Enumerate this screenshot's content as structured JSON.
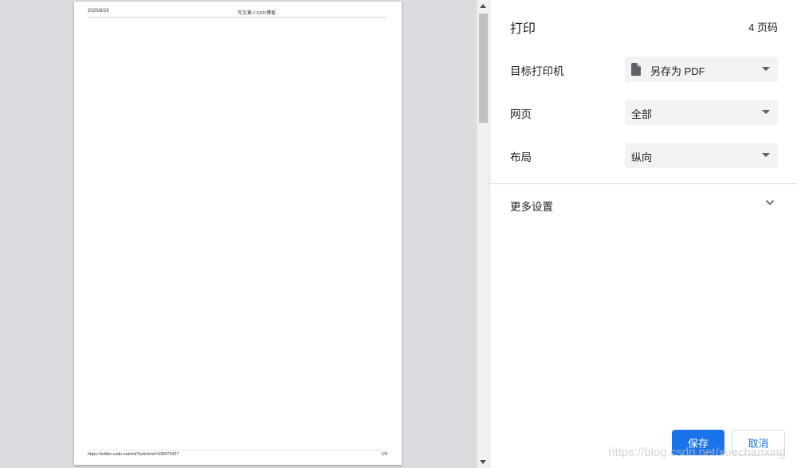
{
  "preview": {
    "header_date": "2020/8/26",
    "header_title": "写文章-CSDN博客",
    "footer_url": "https://editor.csdn.net/md?articleId=108973427",
    "footer_page": "1/4"
  },
  "panel": {
    "title": "打印",
    "page_count": "4 页码",
    "destination": {
      "label": "目标打印机",
      "value": "另存为 PDF",
      "icon": "document-icon"
    },
    "pages": {
      "label": "网页",
      "value": "全部"
    },
    "layout": {
      "label": "布局",
      "value": "纵向"
    },
    "more_settings": {
      "label": "更多设置",
      "icon": "chevron-down-icon"
    },
    "save_label": "保存",
    "cancel_label": "取消"
  },
  "watermark": "https://blog.csdn.net/xuechanxing",
  "colors": {
    "accent": "#1a73e8",
    "preview_bg": "#dadce0",
    "select_bg": "#f1f3f4"
  }
}
